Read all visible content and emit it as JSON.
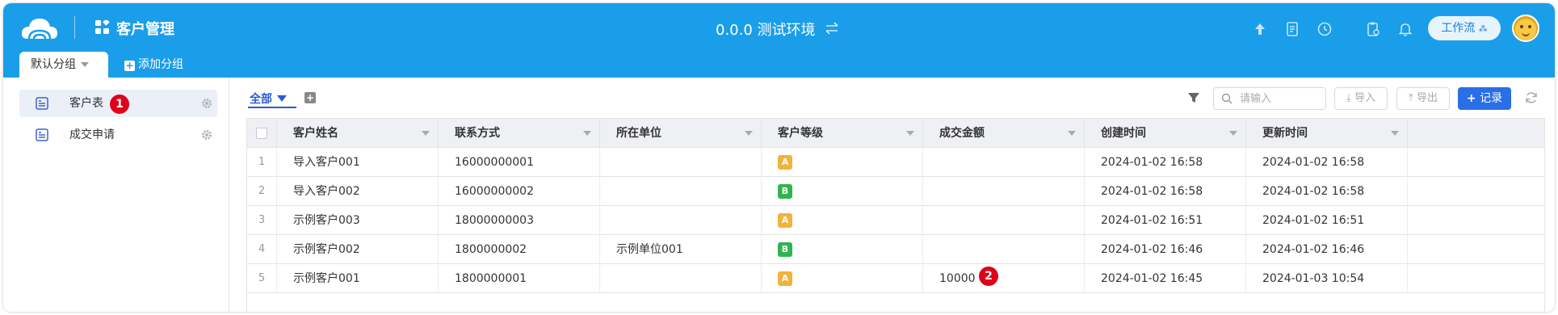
{
  "header": {
    "app_title": "客户管理",
    "env_title": "0.0.0 测试环境",
    "workflow_label": "工作流"
  },
  "tabs": {
    "default_group": "默认分组",
    "add_group": "添加分组"
  },
  "sidebar": {
    "items": [
      {
        "label": "客户表",
        "badge": "1"
      },
      {
        "label": "成交申请"
      }
    ]
  },
  "toolbar": {
    "view_label": "全部",
    "search_placeholder": "请输入",
    "import_label": "导入",
    "export_label": "导出",
    "record_label": "记录"
  },
  "table": {
    "columns": [
      "客户姓名",
      "联系方式",
      "所在单位",
      "客户等级",
      "成交金额",
      "创建时间",
      "更新时间"
    ],
    "rows": [
      {
        "no": "1",
        "name": "导入客户001",
        "contact": "16000000001",
        "company": "",
        "level": "A",
        "amount": "",
        "created": "2024-01-02 16:58",
        "updated": "2024-01-02 16:58"
      },
      {
        "no": "2",
        "name": "导入客户002",
        "contact": "16000000002",
        "company": "",
        "level": "B",
        "amount": "",
        "created": "2024-01-02 16:58",
        "updated": "2024-01-02 16:58"
      },
      {
        "no": "3",
        "name": "示例客户003",
        "contact": "18000000003",
        "company": "",
        "level": "A",
        "amount": "",
        "created": "2024-01-02 16:51",
        "updated": "2024-01-02 16:51"
      },
      {
        "no": "4",
        "name": "示例客户002",
        "contact": "1800000002",
        "company": "示例单位001",
        "level": "B",
        "amount": "",
        "created": "2024-01-02 16:46",
        "updated": "2024-01-02 16:46"
      },
      {
        "no": "5",
        "name": "示例客户001",
        "contact": "1800000001",
        "company": "",
        "level": "A",
        "amount": "10000",
        "created": "2024-01-02 16:45",
        "updated": "2024-01-03 10:54",
        "amount_badge": "2"
      }
    ]
  },
  "colors": {
    "header_bg": "#1a9eea",
    "primary": "#2a6ee8",
    "level_a": "#f0b33c",
    "level_b": "#2fb54f",
    "badge_red": "#e0001b"
  }
}
